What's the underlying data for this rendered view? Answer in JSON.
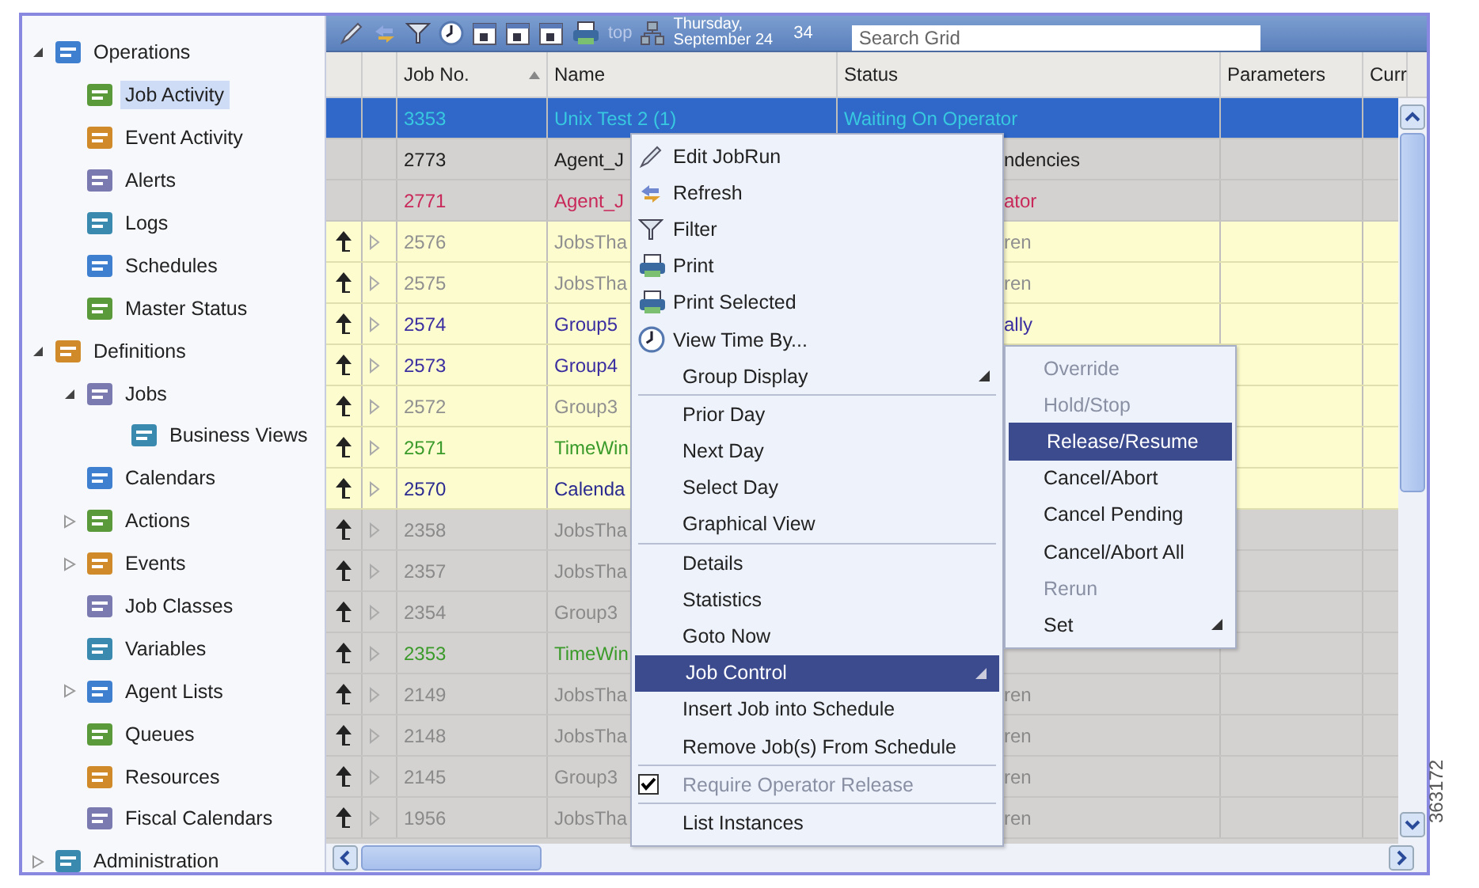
{
  "sidebar": {
    "items": [
      {
        "label": "Operations",
        "expanded": true,
        "selected": false,
        "children": [
          {
            "label": "Job Activity",
            "selected": true
          },
          {
            "label": "Event Activity",
            "selected": false
          },
          {
            "label": "Alerts",
            "selected": false
          },
          {
            "label": "Logs",
            "selected": false
          },
          {
            "label": "Schedules",
            "selected": false
          },
          {
            "label": "Master Status",
            "selected": false
          }
        ]
      },
      {
        "label": "Definitions",
        "expanded": true,
        "selected": false,
        "children": [
          {
            "label": "Jobs",
            "expanded": true,
            "selected": false,
            "children": [
              {
                "label": "Business Views",
                "selected": false
              }
            ]
          },
          {
            "label": "Calendars",
            "selected": false
          },
          {
            "label": "Actions",
            "expanded": false,
            "selected": false
          },
          {
            "label": "Events",
            "expanded": false,
            "selected": false
          },
          {
            "label": "Job Classes",
            "selected": false
          },
          {
            "label": "Variables",
            "selected": false
          },
          {
            "label": "Agent Lists",
            "expanded": false,
            "selected": false
          },
          {
            "label": "Queues",
            "selected": false
          },
          {
            "label": "Resources",
            "selected": false
          },
          {
            "label": "Fiscal Calendars",
            "selected": false
          }
        ]
      },
      {
        "label": "Administration",
        "expanded": false,
        "selected": false
      }
    ]
  },
  "toolbar": {
    "top_label": "top",
    "date": [
      "Thursday,",
      "September 24"
    ],
    "count": "34",
    "search": {
      "placeholder": "Search Grid"
    }
  },
  "table": {
    "columns": [
      "Job No.",
      "Name",
      "Status",
      "Parameters",
      "Curr"
    ],
    "rows": [
      {
        "kind": "plain",
        "selected": true,
        "highlighted": false,
        "color": "#38c8e0",
        "job_no": "3353",
        "name": "Unix Test 2 (1)",
        "status": "Waiting On Operator",
        "status_cut": false
      },
      {
        "kind": "plain",
        "selected": false,
        "highlighted": false,
        "color": "#202020",
        "job_no": "2773",
        "name": "Agent_J",
        "status": "ndencies",
        "status_cut": true
      },
      {
        "kind": "plain",
        "selected": false,
        "highlighted": false,
        "color": "#c8285a",
        "job_no": "2771",
        "name": "Agent_J",
        "status": "ator",
        "status_cut": true
      },
      {
        "kind": "tree",
        "selected": false,
        "highlighted": true,
        "color": "#909090",
        "job_no": "2576",
        "name": "JobsTha",
        "status": "ren",
        "status_cut": true
      },
      {
        "kind": "tree",
        "selected": false,
        "highlighted": true,
        "color": "#909090",
        "job_no": "2575",
        "name": "JobsTha",
        "status": "ren",
        "status_cut": true
      },
      {
        "kind": "tree",
        "selected": false,
        "highlighted": true,
        "color": "#3a2ea0",
        "job_no": "2574",
        "name": "Group5",
        "status": "ally",
        "status_cut": true
      },
      {
        "kind": "tree",
        "selected": false,
        "highlighted": true,
        "color": "#3a2ea0",
        "job_no": "2573",
        "name": "Group4"
      },
      {
        "kind": "tree",
        "selected": false,
        "highlighted": true,
        "color": "#909090",
        "job_no": "2572",
        "name": "Group3"
      },
      {
        "kind": "tree",
        "selected": false,
        "highlighted": true,
        "color": "#3a9a2a",
        "job_no": "2571",
        "name": "TimeWin"
      },
      {
        "kind": "tree",
        "selected": false,
        "highlighted": true,
        "color": "#2a2a90",
        "job_no": "2570",
        "name": "Calenda"
      },
      {
        "kind": "tree",
        "selected": false,
        "highlighted": false,
        "color": "#8a8a8a",
        "job_no": "2358",
        "name": "JobsTha"
      },
      {
        "kind": "tree",
        "selected": false,
        "highlighted": false,
        "color": "#8a8a8a",
        "job_no": "2357",
        "name": "JobsTha"
      },
      {
        "kind": "tree",
        "selected": false,
        "highlighted": false,
        "color": "#8a8a8a",
        "job_no": "2354",
        "name": "Group3"
      },
      {
        "kind": "tree",
        "selected": false,
        "highlighted": false,
        "color": "#3a9a2a",
        "job_no": "2353",
        "name": "TimeWin"
      },
      {
        "kind": "tree",
        "selected": false,
        "highlighted": false,
        "color": "#8a8a8a",
        "job_no": "2149",
        "name": "JobsTha",
        "status": "ren",
        "status_cut": true
      },
      {
        "kind": "tree",
        "selected": false,
        "highlighted": false,
        "color": "#8a8a8a",
        "job_no": "2148",
        "name": "JobsTha",
        "status": "ren",
        "status_cut": true
      },
      {
        "kind": "tree",
        "selected": false,
        "highlighted": false,
        "color": "#8a8a8a",
        "job_no": "2145",
        "name": "Group3",
        "status": "ren",
        "status_cut": true
      },
      {
        "kind": "tree",
        "selected": false,
        "highlighted": false,
        "color": "#8a8a8a",
        "job_no": "1956",
        "name": "JobsTha",
        "status": "ren",
        "status_cut": true
      }
    ]
  },
  "context_menu": {
    "items": [
      {
        "label": "Edit JobRun",
        "kind": "icon",
        "selected": false,
        "disabled": false
      },
      {
        "label": "Refresh",
        "kind": "icon",
        "selected": false,
        "disabled": false
      },
      {
        "label": "Filter",
        "kind": "icon",
        "selected": false,
        "disabled": false
      },
      {
        "label": "Print",
        "kind": "icon",
        "selected": false,
        "disabled": false
      },
      {
        "label": "Print Selected",
        "kind": "icon",
        "selected": false,
        "disabled": false
      },
      {
        "label": "View Time By...",
        "kind": "icon",
        "selected": false,
        "disabled": false
      },
      {
        "label": "Group Display",
        "kind": "submenu",
        "selected": false,
        "disabled": false,
        "separator_after": true
      },
      {
        "label": "Prior Day",
        "kind": "plain",
        "selected": false,
        "disabled": false
      },
      {
        "label": "Next Day",
        "kind": "plain",
        "selected": false,
        "disabled": false
      },
      {
        "label": "Select Day",
        "kind": "plain",
        "selected": false,
        "disabled": false
      },
      {
        "label": "Graphical View",
        "kind": "plain",
        "selected": false,
        "disabled": false,
        "separator_after": true
      },
      {
        "label": "Details",
        "kind": "plain",
        "selected": false,
        "disabled": false
      },
      {
        "label": "Statistics",
        "kind": "plain",
        "selected": false,
        "disabled": false
      },
      {
        "label": "Goto Now",
        "kind": "plain",
        "selected": false,
        "disabled": false
      },
      {
        "label": "Job Control",
        "kind": "submenu",
        "selected": true,
        "disabled": false
      },
      {
        "label": "Insert Job into Schedule",
        "kind": "plain",
        "selected": false,
        "disabled": false
      },
      {
        "label": "Remove Job(s) From Schedule",
        "kind": "plain",
        "selected": false,
        "disabled": false,
        "separator_after": true
      },
      {
        "label": "Require Operator Release",
        "kind": "check",
        "checked": true,
        "selected": false,
        "disabled": true,
        "separator_after": true
      },
      {
        "label": "List Instances",
        "kind": "plain",
        "selected": false,
        "disabled": false
      }
    ]
  },
  "submenu": {
    "items": [
      {
        "label": "Override",
        "kind": "plain",
        "selected": false,
        "disabled": true
      },
      {
        "label": "Hold/Stop",
        "kind": "plain",
        "selected": false,
        "disabled": true
      },
      {
        "label": "Release/Resume",
        "kind": "plain",
        "selected": true,
        "disabled": false
      },
      {
        "label": "Cancel/Abort",
        "kind": "plain",
        "selected": false,
        "disabled": false
      },
      {
        "label": "Cancel Pending",
        "kind": "plain",
        "selected": false,
        "disabled": false
      },
      {
        "label": "Cancel/Abort All",
        "kind": "plain",
        "selected": false,
        "disabled": false
      },
      {
        "label": "Rerun",
        "kind": "plain",
        "selected": false,
        "disabled": true
      },
      {
        "label": "Set",
        "kind": "submenu",
        "selected": false,
        "disabled": false
      }
    ]
  },
  "figure_id": "363172"
}
